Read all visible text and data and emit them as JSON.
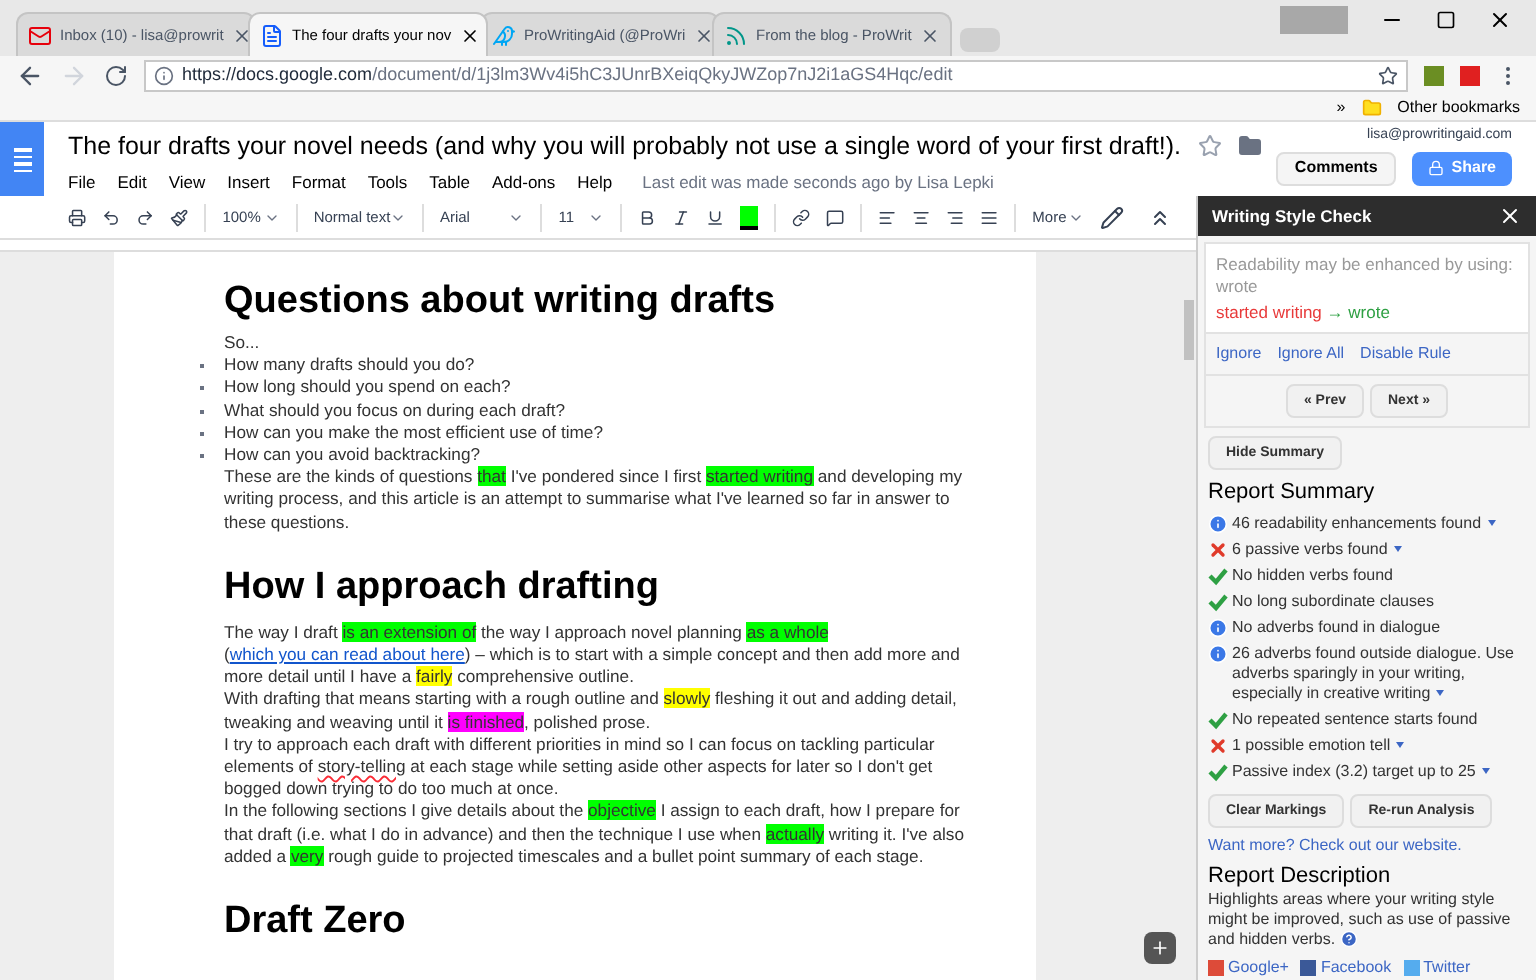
{
  "browser": {
    "tabs": [
      {
        "label": "Inbox (10) - lisa@prowrit",
        "selected": false
      },
      {
        "label": "The four drafts your nov",
        "selected": true
      },
      {
        "label": "ProWritingAid (@ProWri",
        "selected": false
      },
      {
        "label": "From the blog - ProWrit",
        "selected": false
      }
    ],
    "url_host": "https://docs.google.com",
    "url_path": "/document/d/1j3lm3Wv4i5hC3JUnrBXeiqQkyJWZop7nJ2i1aGS4Hqc/edit",
    "bookmarks_chevron": "»",
    "bookmark": "Other bookmarks"
  },
  "doc": {
    "title": "The four drafts your novel needs (and why you will probably not use a single word of your first draft!).",
    "account": "lisa@prowritingaid.com",
    "comments_button": "Comments",
    "share_button": "Share",
    "menu": [
      "File",
      "Edit",
      "View",
      "Insert",
      "Format",
      "Tools",
      "Table",
      "Add-ons",
      "Help"
    ],
    "last_edit": "Last edit was made seconds ago by Lisa Lepki",
    "toolbar": {
      "zoom": "100%",
      "style": "Normal text",
      "font": "Arial",
      "size": "11",
      "more": "More"
    },
    "content": [
      {
        "kind": "heading",
        "text": "Questions about writing drafts"
      },
      {
        "kind": "para",
        "segments": [
          {
            "text": "So..."
          }
        ]
      },
      {
        "kind": "bullet",
        "segments": [
          {
            "text": "How many drafts should you do?"
          }
        ]
      },
      {
        "kind": "bullet",
        "segments": [
          {
            "text": "How long should you spend on each?"
          }
        ]
      },
      {
        "kind": "bullet",
        "segments": [
          {
            "text": "What should you focus on during each draft?"
          }
        ]
      },
      {
        "kind": "bullet",
        "segments": [
          {
            "text": "How can you make the most efficient use of time?"
          }
        ]
      },
      {
        "kind": "bullet",
        "segments": [
          {
            "text": "How can you avoid backtracking?"
          }
        ]
      },
      {
        "kind": "para",
        "segments": [
          {
            "text": "These are the kinds of questions "
          },
          {
            "text": "that",
            "color": "#00ff00"
          },
          {
            "text": " I've pondered since I first "
          },
          {
            "text": "started writing",
            "color": "#00ff00"
          },
          {
            "text": " and developing my writing process, and this article is an attempt to summarise what I've learned so far in answer to these questions."
          }
        ]
      },
      {
        "kind": "heading",
        "text": "How I approach drafting"
      },
      {
        "kind": "para",
        "segments": [
          {
            "text": "The way I draft "
          },
          {
            "text": "is an extension of",
            "color": "#00ff00"
          },
          {
            "text": " the way I approach novel planning "
          },
          {
            "text": "as a whole",
            "color": "#00ff00"
          },
          {
            "text": " ("
          },
          {
            "text": "which you can read about here",
            "kind": "link"
          },
          {
            "text": ") – which is to start with a simple concept and then add more and more detail until I have a "
          },
          {
            "text": "fairly",
            "color": "#ffff00"
          },
          {
            "text": " comprehensive outline."
          }
        ]
      },
      {
        "kind": "para",
        "segments": [
          {
            "text": "With drafting that means starting with a rough outline and "
          },
          {
            "text": "slowly",
            "color": "#ffff00"
          },
          {
            "text": " fleshing it out and adding detail, tweaking and weaving until it "
          },
          {
            "text": "is finished",
            "color": "#ff00ff"
          },
          {
            "text": ", polished prose."
          }
        ]
      },
      {
        "kind": "para",
        "segments": [
          {
            "text": "I try to approach each draft with different priorities in mind so I can focus on tackling particular elements of "
          },
          {
            "text": "story-telling",
            "kind": "misspelt"
          },
          {
            "text": " at each stage while setting aside other aspects for later so I don't get bogged down trying to do too much at once."
          }
        ]
      },
      {
        "kind": "para",
        "segments": [
          {
            "text": "In the following sections I give details about the "
          },
          {
            "text": "objective",
            "color": "#00ff00"
          },
          {
            "text": " I assign to each draft, how I prepare for that draft (i.e. what I do in advance) and then the technique I use when "
          },
          {
            "text": "actually",
            "color": "#00ff00"
          },
          {
            "text": " writing it. I've also added a "
          },
          {
            "text": "very",
            "color": "#00ff00"
          },
          {
            "text": " rough guide to projected timescales and a bullet point summary of each stage."
          }
        ]
      },
      {
        "kind": "heading",
        "text": "Draft Zero"
      }
    ]
  },
  "panel": {
    "title": "Writing Style Check",
    "suggestion": "Readability may be enhanced by using: wrote",
    "from": "started writing",
    "arrow": "→",
    "to": "wrote",
    "actions": [
      "Ignore",
      "Ignore All",
      "Disable Rule"
    ],
    "prev": "« Prev",
    "next": "Next »",
    "hide_summary": "Hide Summary",
    "summary_title": "Report Summary",
    "summary": [
      {
        "kind": "info",
        "text": "46 readability enhancements found",
        "dropdown": true
      },
      {
        "kind": "cross",
        "text": "6 passive verbs found",
        "dropdown": true
      },
      {
        "kind": "check",
        "text": "No hidden verbs found",
        "dropdown": false
      },
      {
        "kind": "check",
        "text": "No long subordinate clauses",
        "dropdown": false
      },
      {
        "kind": "info",
        "text": "No adverbs found in dialogue",
        "dropdown": false
      },
      {
        "kind": "info",
        "text": "26 adverbs found outside dialogue. Use adverbs sparingly in your writing, especially in creative writing",
        "dropdown": true
      },
      {
        "kind": "check",
        "text": "No repeated sentence starts found",
        "dropdown": false
      },
      {
        "kind": "cross",
        "text": "1 possible emotion tell",
        "dropdown": true
      },
      {
        "kind": "check",
        "text": "Passive index (3.2) target up to 25",
        "dropdown": true
      }
    ],
    "clear_button": "Clear Markings",
    "rerun_button": "Re-run Analysis",
    "website_link": "Want more? Check out our website.",
    "description_title": "Report Description",
    "description": "Highlights areas where your writing style might be improved, such as use of passive and hidden verbs.",
    "social": [
      {
        "kind": "gplus",
        "label": "Google+"
      },
      {
        "kind": "facebook",
        "label": "Facebook"
      },
      {
        "kind": "twitter",
        "label": "Twitter"
      }
    ]
  }
}
